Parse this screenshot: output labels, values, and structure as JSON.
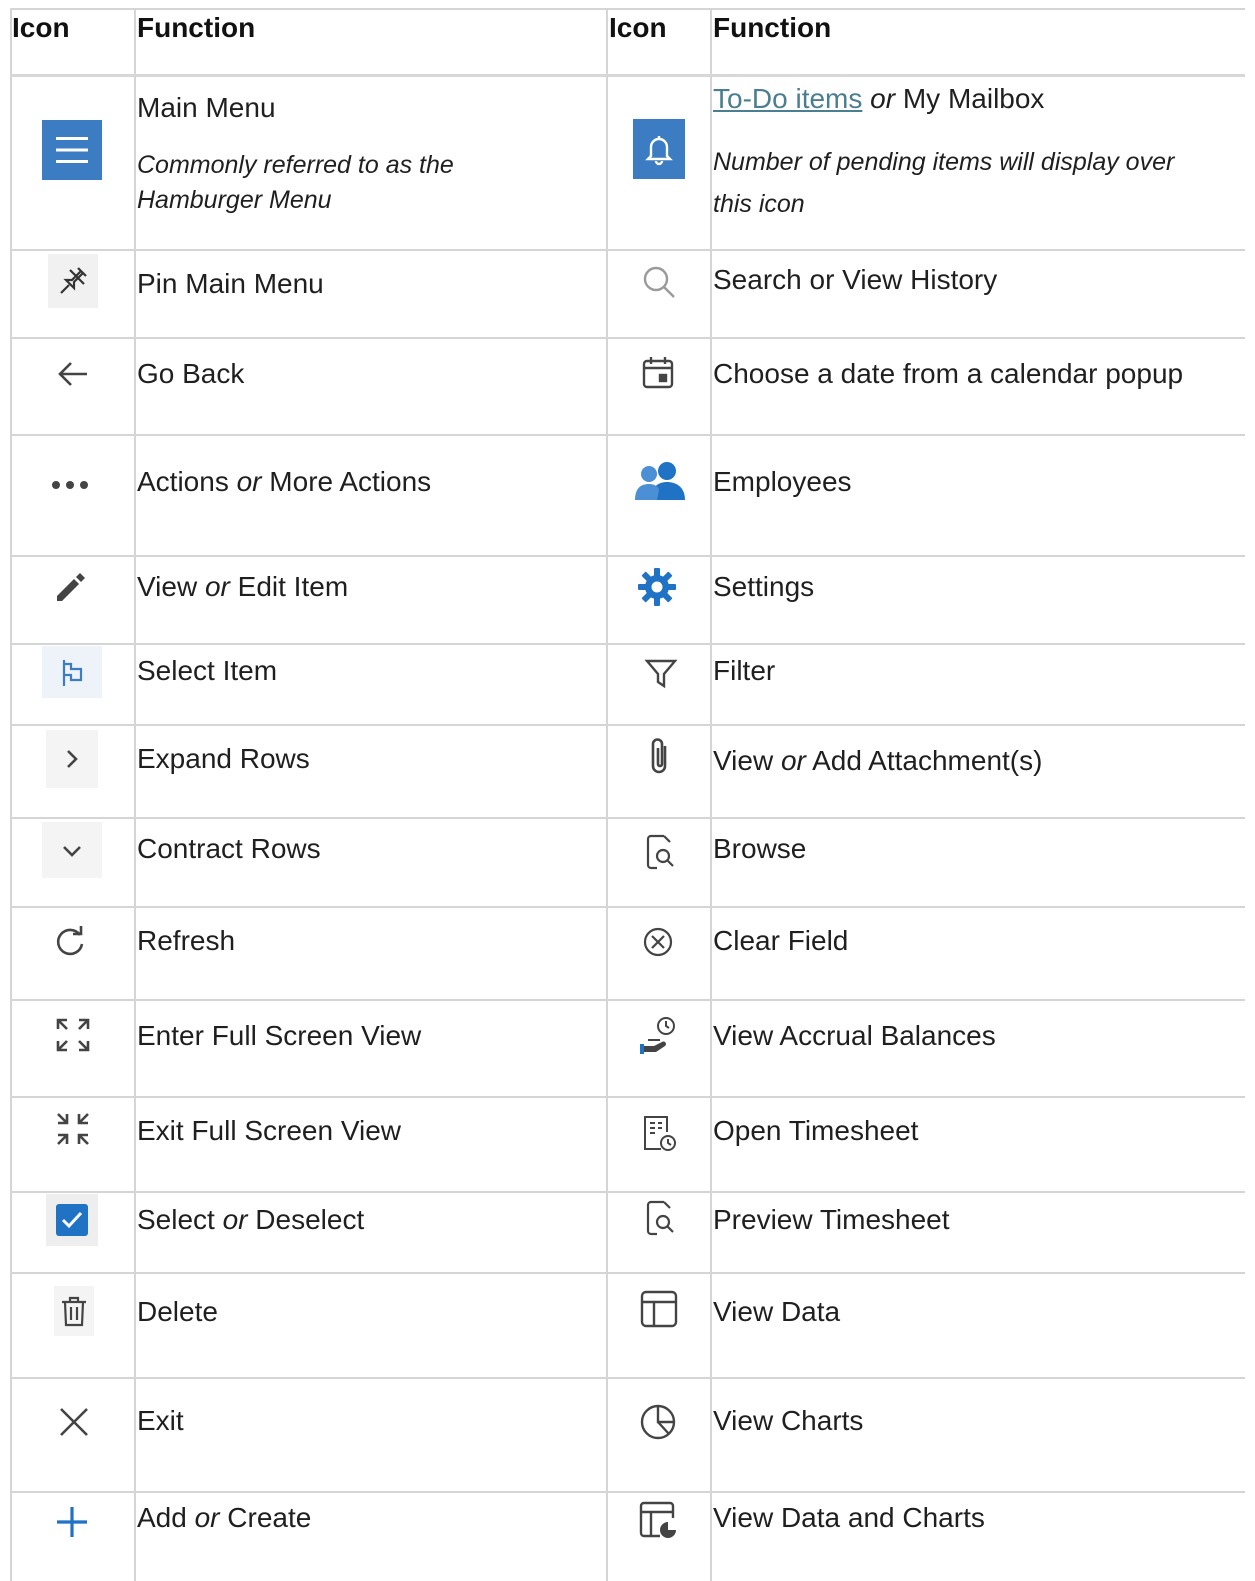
{
  "headers": {
    "left_icon": "Icon",
    "left_function": "Function",
    "right_icon": "Icon",
    "right_function": "Function"
  },
  "left_rows": [
    {
      "icon": "hamburger-menu-icon",
      "label": "Main Menu",
      "note_line1": "Commonly referred to as the",
      "note_line2": "Hamburger Menu"
    },
    {
      "icon": "pin-icon",
      "label": "Pin Main Menu"
    },
    {
      "icon": "arrow-left-icon",
      "label": "Go Back"
    },
    {
      "icon": "ellipsis-icon",
      "label_a": "Actions",
      "connector": "or",
      "label_b": "More Actions"
    },
    {
      "icon": "pencil-icon",
      "label_a": "View",
      "connector": "or",
      "label_b": "Edit Item"
    },
    {
      "icon": "flag-select-icon",
      "label": "Select Item"
    },
    {
      "icon": "chevron-right-icon",
      "label": "Expand Rows"
    },
    {
      "icon": "chevron-down-icon",
      "label": "Contract Rows"
    },
    {
      "icon": "refresh-icon",
      "label": "Refresh"
    },
    {
      "icon": "fullscreen-enter-icon",
      "label": "Enter Full Screen View"
    },
    {
      "icon": "fullscreen-exit-icon",
      "label": "Exit Full Screen View"
    },
    {
      "icon": "checkbox-checked-icon",
      "label_a": "Select",
      "connector": "or",
      "label_b": "Deselect"
    },
    {
      "icon": "trash-icon",
      "label": "Delete"
    },
    {
      "icon": "close-x-icon",
      "label": "Exit"
    },
    {
      "icon": "plus-icon",
      "label_a": "Add",
      "connector": "or",
      "label_b": "Create"
    }
  ],
  "right_rows": [
    {
      "icon": "bell-icon",
      "link": "To-Do items",
      "connector": "or",
      "label_b": "My Mailbox",
      "note_line1": "Number of pending items will display over",
      "note_line2": "this icon"
    },
    {
      "icon": "search-icon",
      "label": "Search or View History"
    },
    {
      "icon": "calendar-icon",
      "label": "Choose a date from a calendar popup"
    },
    {
      "icon": "employees-icon",
      "label": "Employees"
    },
    {
      "icon": "settings-gear-icon",
      "label": "Settings"
    },
    {
      "icon": "filter-icon",
      "label": "Filter"
    },
    {
      "icon": "paperclip-icon",
      "label_a": "View",
      "connector": "or",
      "label_b": "Add Attachment(s)"
    },
    {
      "icon": "browse-icon",
      "label": "Browse"
    },
    {
      "icon": "clear-circle-x-icon",
      "label": "Clear Field"
    },
    {
      "icon": "accrual-balance-icon",
      "label": "View Accrual Balances"
    },
    {
      "icon": "timesheet-icon",
      "label": "Open Timesheet"
    },
    {
      "icon": "preview-icon",
      "label": "Preview Timesheet"
    },
    {
      "icon": "table-data-icon",
      "label": "View Data"
    },
    {
      "icon": "pie-chart-icon",
      "label": "View Charts"
    },
    {
      "icon": "data-chart-icon",
      "label": "View Data and Charts"
    }
  ],
  "colors": {
    "accent_blue": "#3b7cc2",
    "link": "#4a7f91",
    "grid": "#d5d5d5",
    "icon_gray": "#555555"
  }
}
